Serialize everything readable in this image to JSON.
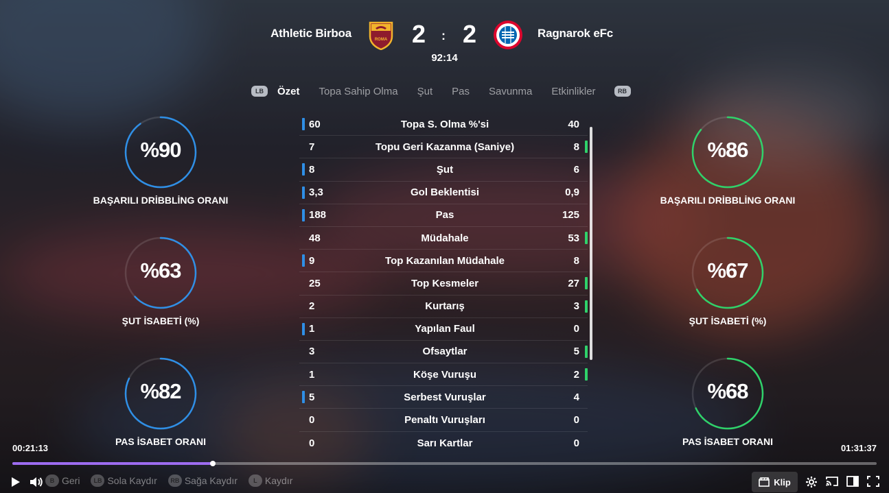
{
  "match": {
    "home_team": "Athletic Birboa",
    "away_team": "Ragnarok eFc",
    "home_score": "2",
    "away_score": "2",
    "separator": ":",
    "clock": "92:14",
    "home_crest_text": "ROMA",
    "away_crest_text": "FC BAYERN MÜNCHEN"
  },
  "tabs": {
    "lb": "LB",
    "rb": "RB",
    "items": [
      "Özet",
      "Topa Sahip Olma",
      "Şut",
      "Pas",
      "Savunma",
      "Etkinlikler"
    ],
    "active": "Özet"
  },
  "gauges": {
    "left": [
      {
        "value": "%90",
        "label": "BAŞARILI DRİBBLİNG ORANI",
        "fraction": 0.9
      },
      {
        "value": "%63",
        "label": "ŞUT İSABETİ (%)",
        "fraction": 0.63
      },
      {
        "value": "%82",
        "label": "PAS İSABET ORANI",
        "fraction": 0.82
      }
    ],
    "right": [
      {
        "value": "%86",
        "label": "BAŞARILI DRİBBLİNG ORANI",
        "fraction": 0.86
      },
      {
        "value": "%67",
        "label": "ŞUT İSABETİ (%)",
        "fraction": 0.67
      },
      {
        "value": "%68",
        "label": "PAS İSABET ORANI",
        "fraction": 0.68
      }
    ],
    "home_color": "#2f8fe6",
    "away_color": "#2fd26a"
  },
  "stats": [
    {
      "name": "Topa S. Olma %'si",
      "home": "60",
      "away": "40",
      "leader": "home"
    },
    {
      "name": "Topu Geri Kazanma (Saniye)",
      "home": "7",
      "away": "8",
      "leader": "away"
    },
    {
      "name": "Şut",
      "home": "8",
      "away": "6",
      "leader": "home"
    },
    {
      "name": "Gol Beklentisi",
      "home": "3,3",
      "away": "0,9",
      "leader": "home"
    },
    {
      "name": "Pas",
      "home": "188",
      "away": "125",
      "leader": "home"
    },
    {
      "name": "Müdahale",
      "home": "48",
      "away": "53",
      "leader": "away"
    },
    {
      "name": "Top Kazanılan Müdahale",
      "home": "9",
      "away": "8",
      "leader": "home"
    },
    {
      "name": "Top Kesmeler",
      "home": "25",
      "away": "27",
      "leader": "away"
    },
    {
      "name": "Kurtarış",
      "home": "2",
      "away": "3",
      "leader": "away"
    },
    {
      "name": "Yapılan Faul",
      "home": "1",
      "away": "0",
      "leader": "home"
    },
    {
      "name": "Ofsaytlar",
      "home": "3",
      "away": "5",
      "leader": "away"
    },
    {
      "name": "Köşe Vuruşu",
      "home": "1",
      "away": "2",
      "leader": "away"
    },
    {
      "name": "Serbest Vuruşlar",
      "home": "5",
      "away": "4",
      "leader": "home"
    },
    {
      "name": "Penaltı Vuruşları",
      "home": "0",
      "away": "0",
      "leader": "none"
    },
    {
      "name": "Sarı Kartlar",
      "home": "0",
      "away": "0",
      "leader": "none"
    }
  ],
  "player": {
    "current_time": "00:21:13",
    "total_time": "01:31:37",
    "progress": 0.2316,
    "progress_color": "#9d6cf0",
    "hints": [
      {
        "chip": "B",
        "label": "Geri"
      },
      {
        "chip": "LB",
        "label": "Sola Kaydır"
      },
      {
        "chip": "RB",
        "label": "Sağa Kaydır"
      },
      {
        "chip": "L",
        "label": "Kaydır"
      }
    ],
    "clip_label": "Klip",
    "icons": [
      "play-icon",
      "volume-icon",
      "clip-icon",
      "settings-icon",
      "cast-icon",
      "theater-mode-icon",
      "fullscreen-icon"
    ]
  }
}
